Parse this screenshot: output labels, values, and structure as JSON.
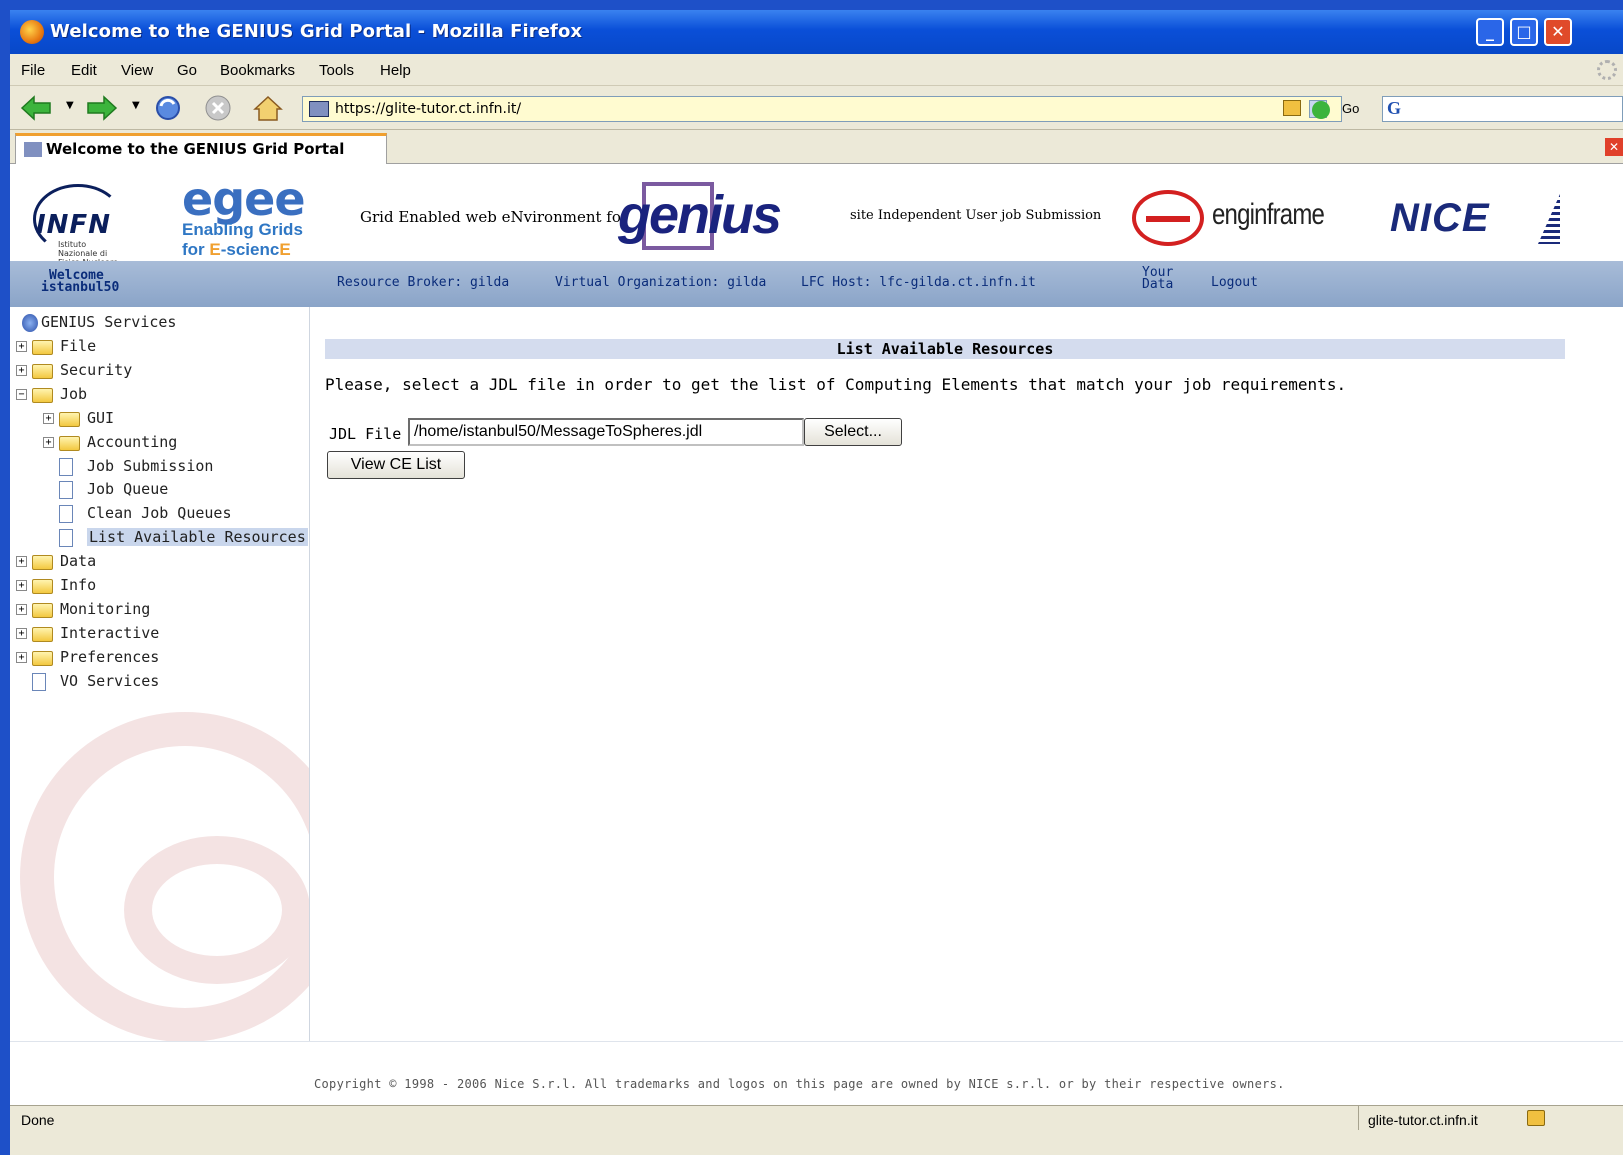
{
  "window": {
    "title": "Welcome to the GENIUS Grid Portal - Mozilla Firefox"
  },
  "menubar": {
    "items": [
      "File",
      "Edit",
      "View",
      "Go",
      "Bookmarks",
      "Tools",
      "Help"
    ]
  },
  "navigation": {
    "url": "https://glite-tutor.ct.infn.it/",
    "go_label": "Go"
  },
  "tab": {
    "label": "Welcome to the GENIUS Grid Portal"
  },
  "banner": {
    "infn_text": "INFN",
    "infn_subtext": "Istituto Nazionale di Fisica Nucleare",
    "egee_logo": "egee",
    "egee_line1_a": "Enabling Grids",
    "egee_line2_a": "for ",
    "egee_line2_b": "E",
    "egee_line2_c": "-scienc",
    "egee_line2_d": "E",
    "grid_env": "Grid Enabled web eNvironment for",
    "genius_logo": "genius",
    "site_independent": "site Independent User job Submission",
    "enginframe_logo": "enginframe",
    "nice_logo": "NICE"
  },
  "infobar": {
    "welcome": "Welcome",
    "username": "istanbul50",
    "resource_broker": "Resource Broker: gilda",
    "virtual_org": "Virtual Organization: gilda",
    "lfc_host": "LFC Host: lfc-gilda.ct.infn.it",
    "your": "Your",
    "data": "Data",
    "logout": "Logout"
  },
  "sidebar": {
    "root": "GENIUS Services",
    "items": [
      {
        "label": "File",
        "type": "folder",
        "expander": "+"
      },
      {
        "label": "Security",
        "type": "folder",
        "expander": "+"
      },
      {
        "label": "Job",
        "type": "folder",
        "expander": "−"
      },
      {
        "label": "GUI",
        "type": "folder",
        "expander": "+"
      },
      {
        "label": "Accounting",
        "type": "folder",
        "expander": "+"
      },
      {
        "label": "Job Submission",
        "type": "doc"
      },
      {
        "label": "Job Queue",
        "type": "doc"
      },
      {
        "label": "Clean Job Queues",
        "type": "doc"
      },
      {
        "label": "List Available Resources",
        "type": "doc",
        "selected": true
      },
      {
        "label": "Data",
        "type": "folder",
        "expander": "+"
      },
      {
        "label": "Info",
        "type": "folder",
        "expander": "+"
      },
      {
        "label": "Monitoring",
        "type": "folder",
        "expander": "+"
      },
      {
        "label": "Interactive",
        "type": "folder",
        "expander": "+"
      },
      {
        "label": "Preferences",
        "type": "folder",
        "expander": "+"
      },
      {
        "label": "VO Services",
        "type": "doc"
      }
    ]
  },
  "main": {
    "title": "List Available Resources",
    "instruction": "Please, select a JDL file in order to get the list of Computing Elements that match your job requirements.",
    "jdl_label": "JDL File",
    "jdl_value": "/home/istanbul50/MessageToSpheres.jdl",
    "select_button": "Select...",
    "view_button": "View CE List"
  },
  "footer": {
    "copyright": "Copyright © 1998 - 2006 Nice S.r.l. All trademarks and logos on this page are owned by NICE s.r.l. or by their respective owners."
  },
  "statusbar": {
    "status": "Done",
    "host": "glite-tutor.ct.infn.it"
  },
  "colors": {
    "titlebar": "#0a4fd8",
    "infobar": "#8aa4c8",
    "selected": "#c9d6ec",
    "header_bar": "#d4dcee"
  }
}
